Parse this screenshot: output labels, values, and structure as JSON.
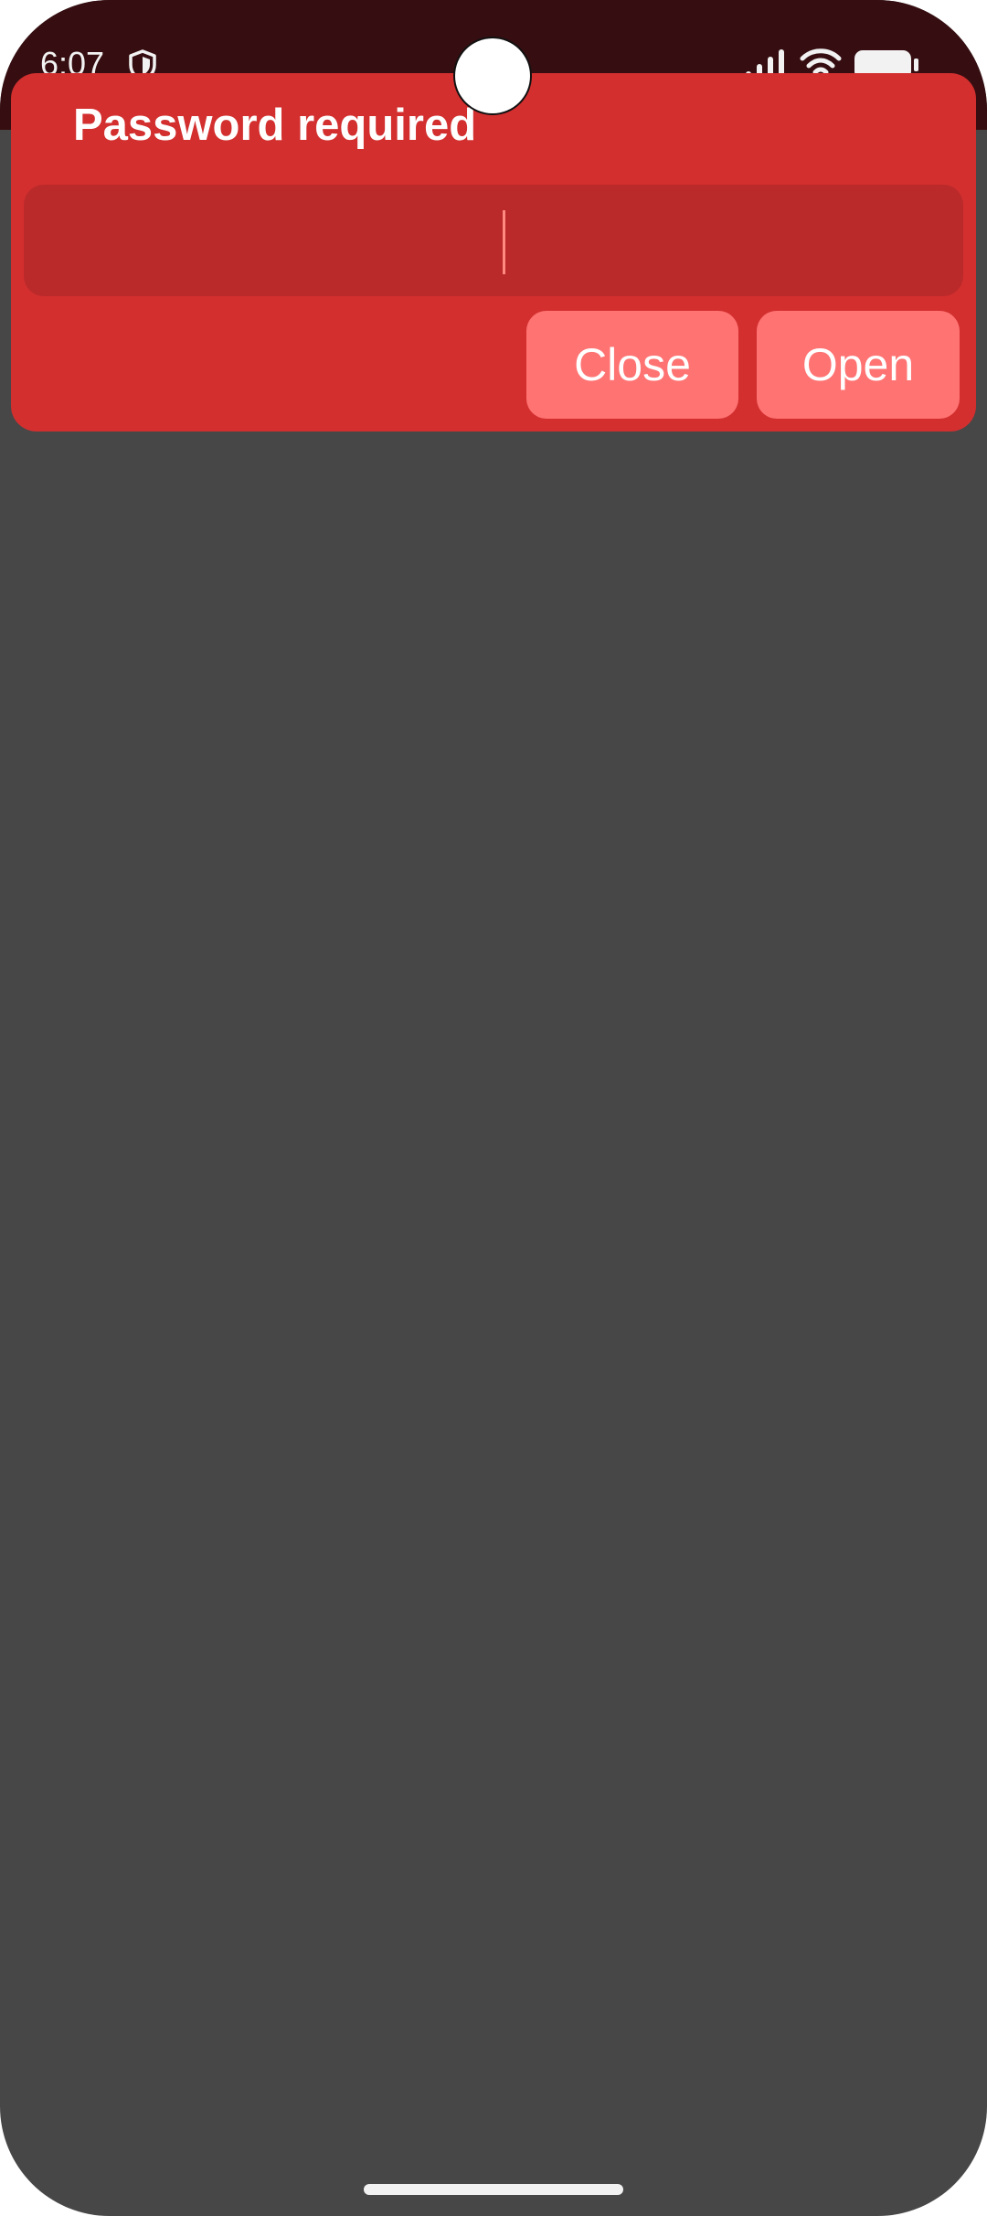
{
  "status_bar": {
    "time": "6:07",
    "icons": [
      "shield-icon",
      "signal-icon",
      "wifi-icon",
      "battery-icon"
    ]
  },
  "dialog": {
    "title": "Password required",
    "password_value": "",
    "close_label": "Close",
    "open_label": "Open"
  },
  "colors": {
    "dialog_bg": "#d32f2f",
    "field_bg": "#bb2a2a",
    "button_bg": "#ff7373",
    "scrim": "#474747",
    "status_bar_bg": "#360e11"
  }
}
